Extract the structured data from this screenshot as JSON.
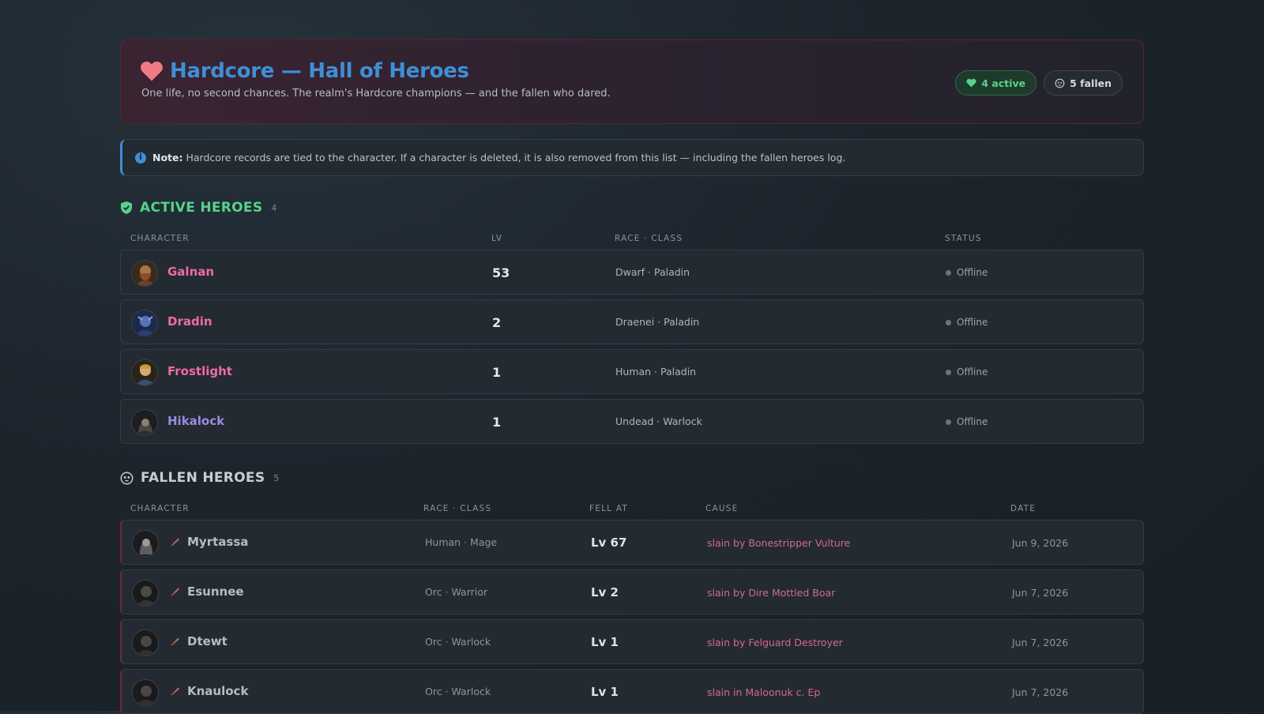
{
  "header": {
    "title": "Hardcore — Hall of Heroes",
    "subtitle": "One life, no second chances. The realm's Hardcore champions — and the fallen who dared.",
    "active_badge": "4 active",
    "fallen_badge": "5 fallen"
  },
  "note": {
    "label": "Note:",
    "text": "Hardcore records are tied to the character. If a character is deleted, it is also removed from this list — including the fallen heroes log."
  },
  "active": {
    "title": "ACTIVE HEROES",
    "count": "4",
    "columns": [
      "CHARACTER",
      "LV",
      "RACE · CLASS",
      "STATUS"
    ],
    "rows": [
      {
        "name": "Galnan",
        "level": "53",
        "race_class": "Dwarf · Paladin",
        "status": "Offline",
        "color": "#f06aa8"
      },
      {
        "name": "Dradin",
        "level": "2",
        "race_class": "Draenei · Paladin",
        "status": "Offline",
        "color": "#f06aa8"
      },
      {
        "name": "Frostlight",
        "level": "1",
        "race_class": "Human · Paladin",
        "status": "Offline",
        "color": "#f06aa8"
      },
      {
        "name": "Hikalock",
        "level": "1",
        "race_class": "Undead · Warlock",
        "status": "Offline",
        "color": "#9b8be0"
      }
    ]
  },
  "fallen": {
    "title": "FALLEN HEROES",
    "count": "5",
    "columns": [
      "CHARACTER",
      "RACE · CLASS",
      "FELL AT",
      "CAUSE",
      "DATE"
    ],
    "rows": [
      {
        "name": "Myrtassa",
        "race_class": "Human · Mage",
        "fell_at": "Lv 67",
        "cause": "slain by Bonestripper Vulture",
        "date": "Jun 9, 2026"
      },
      {
        "name": "Esunnee",
        "race_class": "Orc · Warrior",
        "fell_at": "Lv 2",
        "cause": "slain by Dire Mottled Boar",
        "date": "Jun 7, 2026"
      },
      {
        "name": "Dtewt",
        "race_class": "Orc · Warlock",
        "fell_at": "Lv 1",
        "cause": "slain by Felguard Destroyer",
        "date": "Jun 7, 2026"
      },
      {
        "name": "Knaulock",
        "race_class": "Orc · Warlock",
        "fell_at": "Lv 1",
        "cause": "slain in Maloonuk c. Ep",
        "date": "Jun 7, 2026"
      }
    ]
  }
}
